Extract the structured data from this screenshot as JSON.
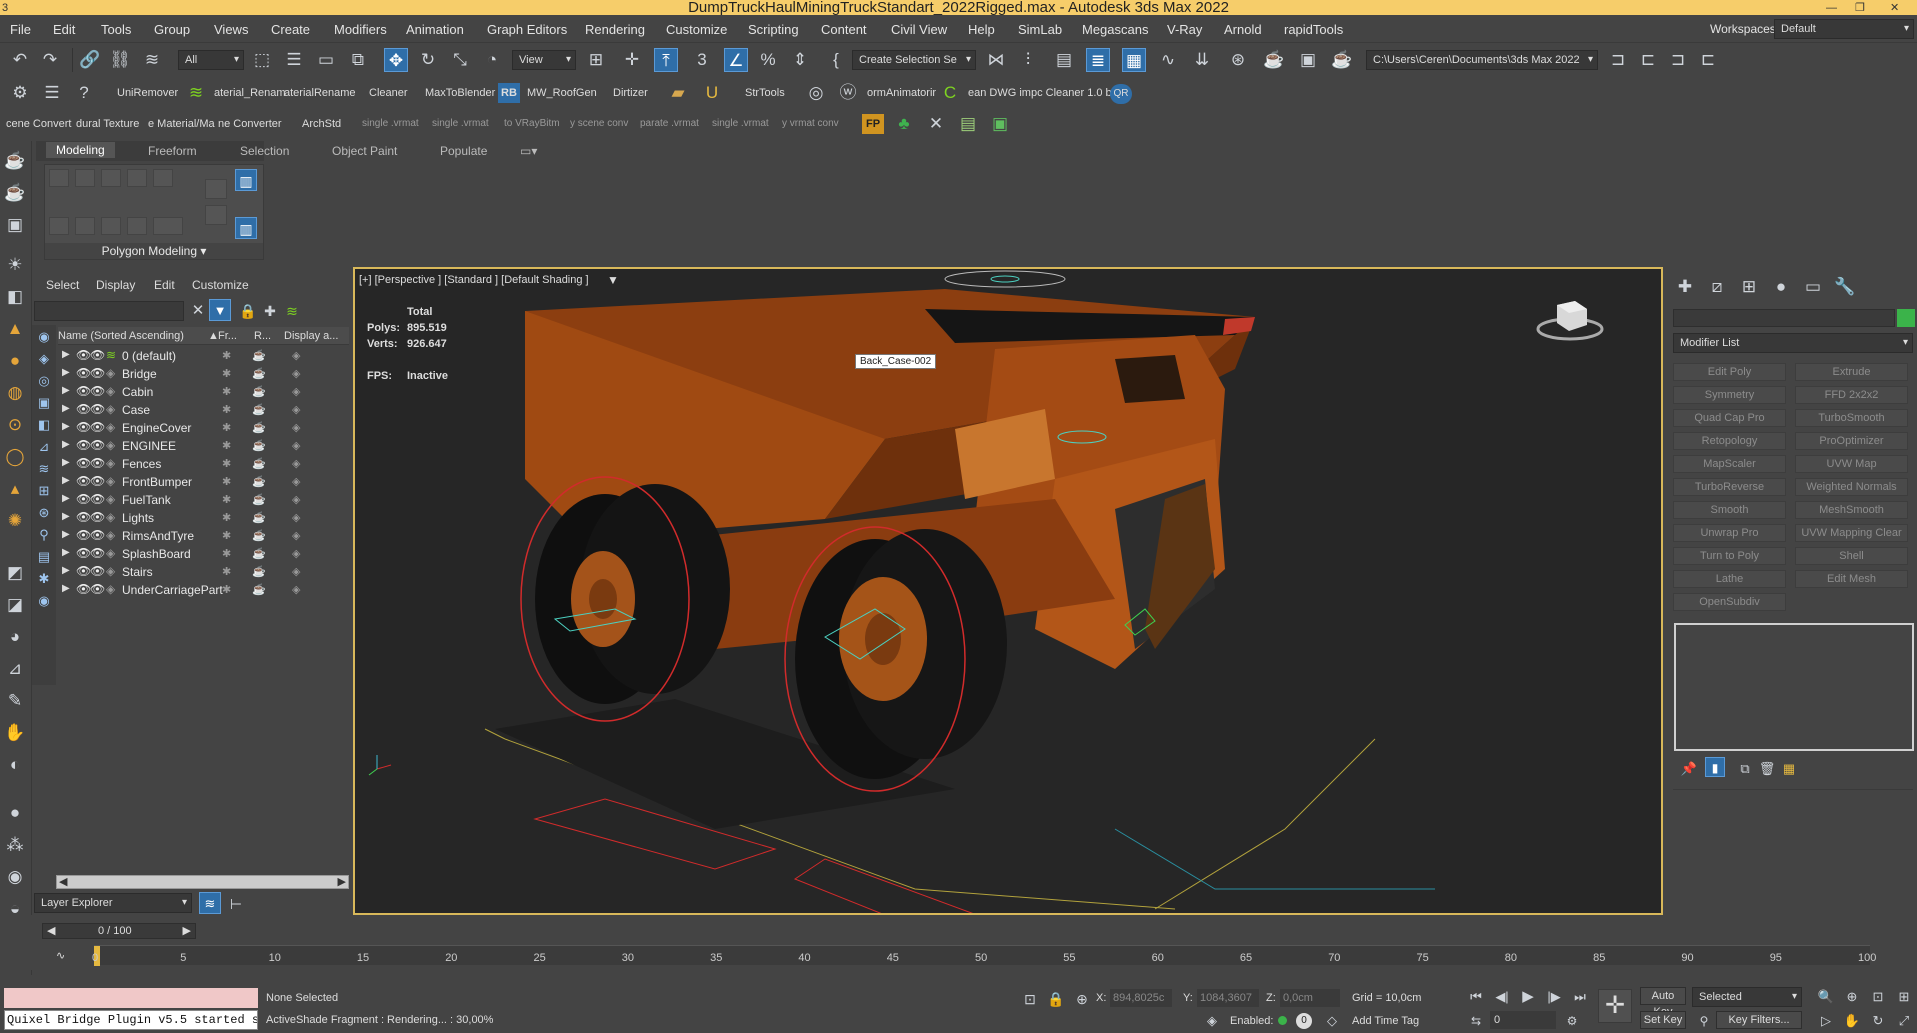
{
  "window": {
    "title": "DumpTruckHaulMiningTruckStandart_2022Rigged.max - Autodesk 3ds Max 2022"
  },
  "menu": [
    "File",
    "Edit",
    "Tools",
    "Group",
    "Views",
    "Create",
    "Modifiers",
    "Animation",
    "Graph Editors",
    "Rendering",
    "Customize",
    "Scripting",
    "Content",
    "Civil View",
    "Help",
    "SimLab",
    "Megascans",
    "V-Ray",
    "Arnold",
    "rapidTools"
  ],
  "workspace": {
    "label": "Workspaces:",
    "value": "Default"
  },
  "toolbar1": {
    "selection_filter": "All",
    "view_dropdown": "View",
    "create_selection_set": "Create Selection Se",
    "project_path": "C:\\Users\\Ceren\\Documents\\3ds Max 2022"
  },
  "toolbar2": {
    "items": [
      "UniRemover",
      "aterial_Renam",
      "aterialRename",
      "Cleaner",
      "MaxToBlender",
      "MW_RoofGen",
      "Dirtizer",
      "StrTools",
      "ormAnimatorir",
      "ean DWG impc Cleaner 1.0 b"
    ],
    "rb_badge": "RB",
    "qr_badge": "QR"
  },
  "toolbar3": {
    "items": [
      "cene Convert",
      "dural Texture",
      "e Material/Ma",
      "ne Converter",
      "ArchStd"
    ],
    "dim_items": [
      "single .vrmat",
      "single .vrmat",
      "to VRayBitm",
      "y scene conv",
      "parate .vrmat",
      "single .vrmat",
      "y vrmat conv"
    ],
    "fp_badge": "FP"
  },
  "ribbon": {
    "tabs": [
      "Modeling",
      "Freeform",
      "Selection",
      "Object Paint",
      "Populate"
    ],
    "panel_label": "Polygon Modeling"
  },
  "scene_explorer": {
    "menu": [
      "Select",
      "Display",
      "Edit",
      "Customize"
    ],
    "columns": [
      "Name (Sorted Ascending)",
      "Fr...",
      "R...",
      "Display a..."
    ],
    "layers": [
      "0 (default)",
      "Bridge",
      "Cabin",
      "Case",
      "EngineCover",
      "ENGINEE",
      "Fences",
      "FrontBumper",
      "FuelTank",
      "Lights",
      "RimsAndTyre",
      "SplashBoard",
      "Stairs",
      "UnderCarriagePart"
    ],
    "footer_label": "Layer Explorer"
  },
  "viewport": {
    "label": "[+] [Perspective ] [Standard ] [Default Shading ]",
    "stats": {
      "header": "Total",
      "polys_label": "Polys:",
      "polys": "895.519",
      "verts_label": "Verts:",
      "verts": "926.647",
      "fps_label": "FPS:",
      "fps": "Inactive"
    },
    "tooltip": "Back_Case-002",
    "colors": {
      "truck": "#b45416",
      "selection": "#d8b85a"
    }
  },
  "command_panel": {
    "modifier_list": "Modifier List",
    "buttons": [
      "Edit Poly",
      "Extrude",
      "Symmetry",
      "FFD 2x2x2",
      "Quad Cap Pro",
      "TurboSmooth",
      "Retopology",
      "ProOptimizer",
      "MapScaler",
      "UVW Map",
      "TurboReverse",
      "Weighted Normals",
      "Smooth",
      "MeshSmooth",
      "Unwrap Pro",
      "UVW Mapping Clear",
      "Turn to Poly",
      "Shell",
      "Lathe",
      "Edit Mesh",
      "OpenSubdiv"
    ]
  },
  "timeline": {
    "frame": "0 / 100",
    "ticks": [
      "0",
      "5",
      "10",
      "15",
      "20",
      "25",
      "30",
      "35",
      "40",
      "45",
      "50",
      "55",
      "60",
      "65",
      "70",
      "75",
      "80",
      "85",
      "90",
      "95",
      "100"
    ]
  },
  "status": {
    "selection": "None Selected",
    "message": "ActiveShade Fragment : Rendering... : 30,00%",
    "listener": "Quixel Bridge Plugin v5.5 started s",
    "x_label": "X:",
    "x": "894,8025c",
    "y_label": "Y:",
    "y": "1084,3607",
    "z_label": "Z:",
    "z": "0,0cm",
    "grid": "Grid = 10,0cm",
    "enabled": "Enabled:",
    "add_time_tag": "Add Time Tag",
    "auto_key": "Auto Key",
    "set_key": "Set Key",
    "key_mode": "Selected",
    "key_filters": "Key Filters...",
    "frame_field": "0"
  }
}
